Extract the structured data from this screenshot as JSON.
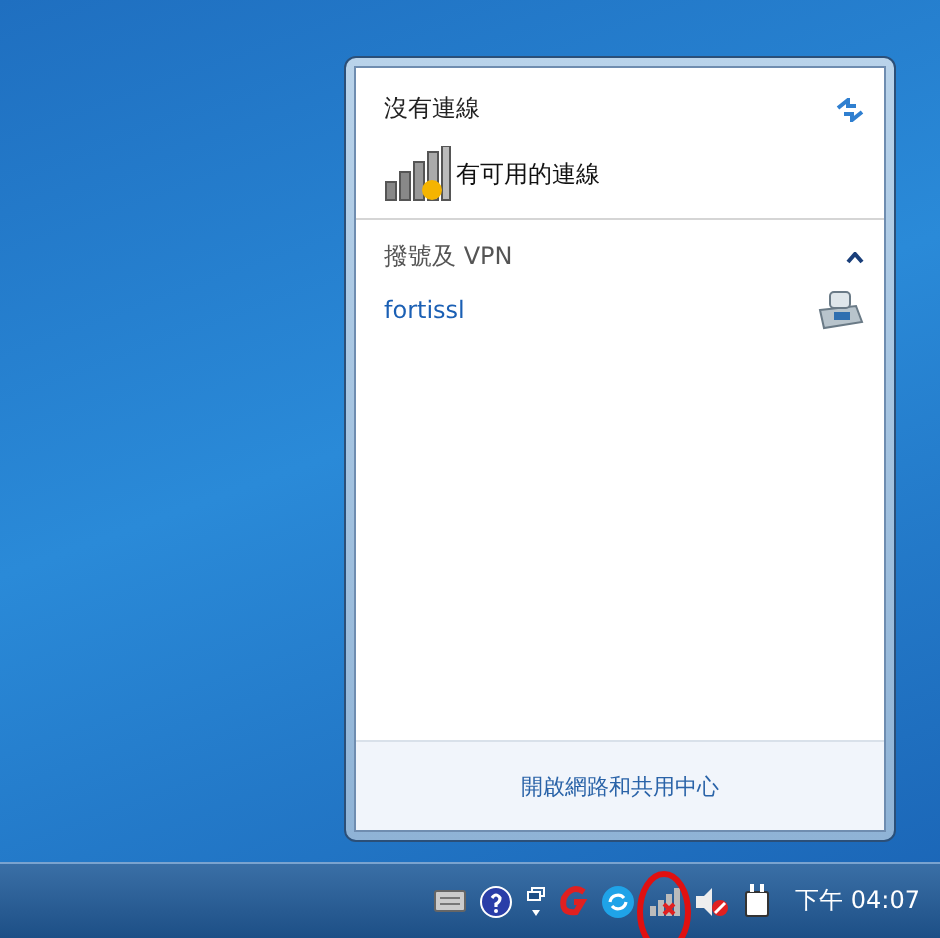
{
  "popup": {
    "status": "沒有連線",
    "available": "有可用的連線",
    "sections": [
      {
        "title": "撥號及 VPN",
        "expanded": true,
        "items": [
          {
            "name": "fortissl"
          }
        ]
      }
    ],
    "footer_link": "開啟網路和共用中心"
  },
  "taskbar": {
    "clock": "下午 04:07"
  }
}
